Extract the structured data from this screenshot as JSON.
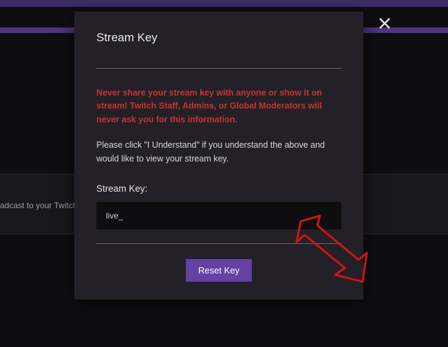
{
  "background": {
    "strip_text": "adcast to your Twitch"
  },
  "modal": {
    "title": "Stream Key",
    "warning": "Never share your stream key with anyone or show it on stream! Twitch Staff, Admins, or Global Moderators will never ask you for this information.",
    "instruction": "Please click \"I Understand\" if you understand the above and would like to view your stream key.",
    "field_label": "Stream Key:",
    "stream_key_value": "live_",
    "reset_button_label": "Reset Key"
  }
}
